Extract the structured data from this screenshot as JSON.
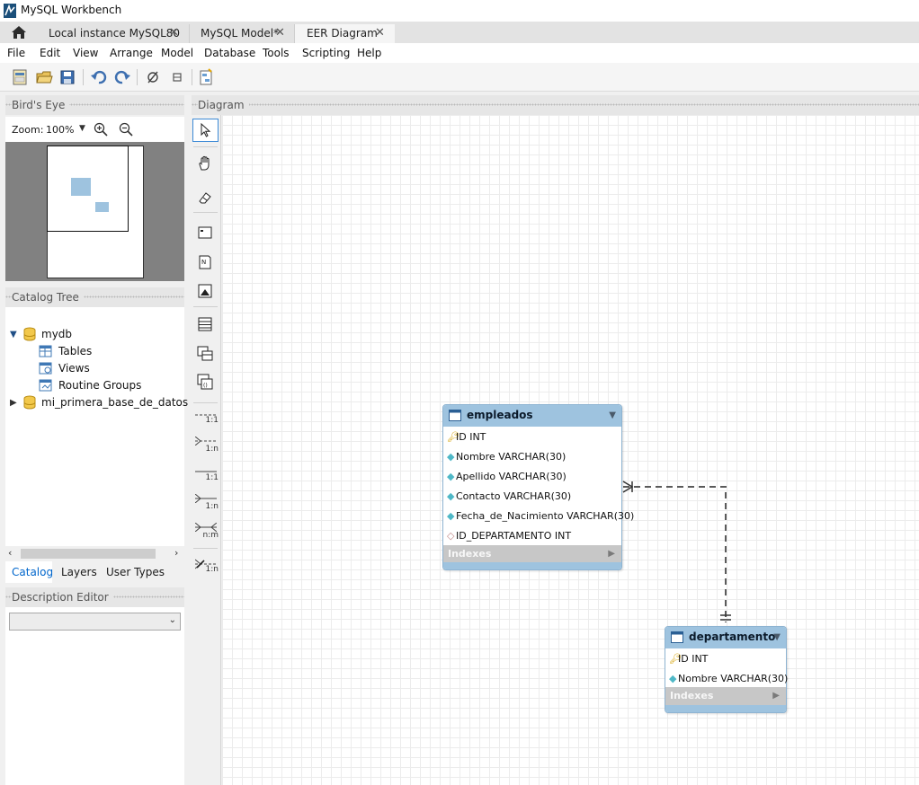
{
  "window": {
    "title": "MySQL Workbench"
  },
  "tabs": [
    {
      "label": "Local instance MySQL80"
    },
    {
      "label": "MySQL Model*"
    },
    {
      "label": "EER Diagram"
    }
  ],
  "menu": [
    "File",
    "Edit",
    "View",
    "Arrange",
    "Model",
    "Database",
    "Tools",
    "Scripting",
    "Help"
  ],
  "toolbar_icons": [
    "new-model-icon",
    "open-model-icon",
    "save-model-icon",
    "undo-icon",
    "redo-icon",
    "toggle-grid-icon",
    "align-grid-icon",
    "new-diagram-icon"
  ],
  "birds_eye": {
    "title": "Bird's Eye",
    "zoom_label": "Zoom:",
    "zoom_value": "100%"
  },
  "catalog": {
    "title": "Catalog Tree",
    "items": [
      {
        "label": "mydb",
        "expanded": true
      },
      {
        "label": "Tables"
      },
      {
        "label": "Views"
      },
      {
        "label": "Routine Groups"
      },
      {
        "label": "mi_primera_base_de_datos",
        "expanded": false
      }
    ]
  },
  "bottom_tabs": [
    "Catalog",
    "Layers",
    "User Types"
  ],
  "description_editor": {
    "title": "Description Editor",
    "selected": ""
  },
  "diagram": {
    "title": "Diagram",
    "relationship_labels": [
      "1:1",
      "1:n",
      "1:1",
      "1:n",
      "n:m",
      "1:n"
    ]
  },
  "entities": [
    {
      "name": "empleados",
      "columns": [
        {
          "text": "ID INT",
          "kind": "primary-key"
        },
        {
          "text": "Nombre VARCHAR(30)",
          "kind": "column"
        },
        {
          "text": "Apellido VARCHAR(30)",
          "kind": "column"
        },
        {
          "text": "Contacto VARCHAR(30)",
          "kind": "column"
        },
        {
          "text": "Fecha_de_Nacimiento VARCHAR(30)",
          "kind": "column"
        },
        {
          "text": "ID_DEPARTAMENTO INT",
          "kind": "nullable-column"
        }
      ],
      "indexes_label": "Indexes"
    },
    {
      "name": "departamento",
      "columns": [
        {
          "text": "ID INT",
          "kind": "primary-key"
        },
        {
          "text": "Nombre VARCHAR(30)",
          "kind": "column"
        }
      ],
      "indexes_label": "Indexes"
    }
  ],
  "colors": {
    "entity_header": "#9ec3df",
    "indexes_bar": "#c7c7c7",
    "accent": "#0066cc"
  }
}
